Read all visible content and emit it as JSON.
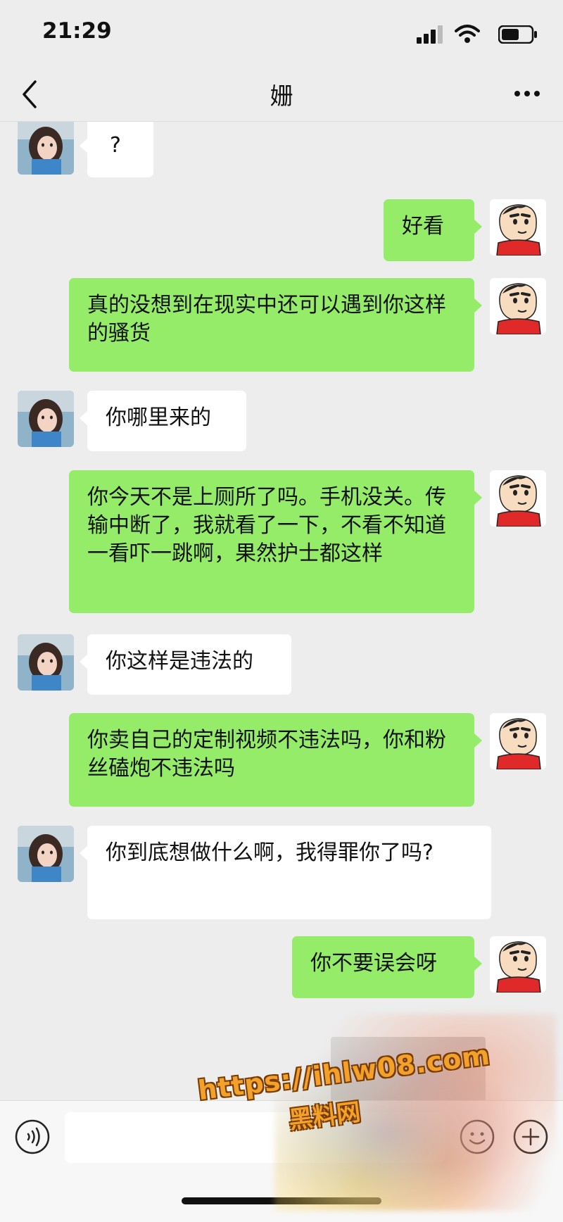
{
  "status_bar": {
    "time": "21:29"
  },
  "header": {
    "title": "姗"
  },
  "messages": [
    {
      "from": "contact",
      "text": "?"
    },
    {
      "from": "me",
      "text": "好看"
    },
    {
      "from": "me",
      "text": "真的没想到在现实中还可以遇到你这样的骚货"
    },
    {
      "from": "contact",
      "text": "你哪里来的"
    },
    {
      "from": "me",
      "text": "你今天不是上厕所了吗。手机没关。传输中断了，我就看了一下，不看不知道一看吓一跳啊，果然护士都这样"
    },
    {
      "from": "contact",
      "text": "你这样是违法的"
    },
    {
      "from": "me",
      "text": "你卖自己的定制视频不违法吗，你和粉丝磕炮不违法吗"
    },
    {
      "from": "contact",
      "text": "你到底想做什么啊，我得罪你了吗?"
    },
    {
      "from": "me",
      "text": "你不要误会呀"
    }
  ],
  "input_bar": {
    "placeholder": ""
  },
  "watermark": {
    "url": "https://ihlw08.com",
    "site_name": "黑料网"
  },
  "colors": {
    "sent_bubble": "#95ec69",
    "received_bubble": "#ffffff",
    "background": "#ededed"
  }
}
